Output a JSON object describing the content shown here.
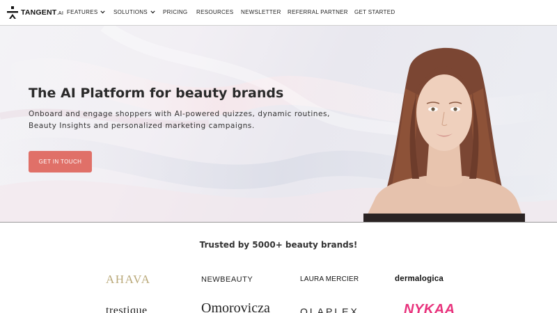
{
  "nav": {
    "logo_text": "TANGENT",
    "logo_suffix": ".AI",
    "items": [
      {
        "label": "FEATURES",
        "has_dropdown": true
      },
      {
        "label": "SOLUTIONS",
        "has_dropdown": true
      },
      {
        "label": "PRICING",
        "has_dropdown": false
      },
      {
        "label": "RESOURCES",
        "has_dropdown": false
      },
      {
        "label": "NEWSLETTER",
        "has_dropdown": false
      },
      {
        "label": "REFERRAL PARTNER",
        "has_dropdown": false
      },
      {
        "label": "GET STARTED",
        "has_dropdown": false
      }
    ]
  },
  "hero": {
    "title": "The AI Platform for beauty brands",
    "subtitle": "Onboard and engage shoppers with AI-powered quizzes, dynamic routines, Beauty Insights and personalized marketing campaigns.",
    "cta_label": "GET IN TOUCH"
  },
  "brands": {
    "heading": "Trusted by 5000+ beauty brands!",
    "logos": [
      "AHAVA",
      "NEWBEAUTY",
      "LAURA MERCIER",
      "dermalogica",
      "trestique",
      "Omorovicza",
      "OLAPLEX",
      "NYKAA"
    ]
  },
  "colors": {
    "accent": "#e07068",
    "nykaa": "#e8327c",
    "ahava": "#b9a878"
  },
  "icons": {
    "logo": "tangent-logo-icon",
    "dropdown": "chevron-down-icon"
  }
}
